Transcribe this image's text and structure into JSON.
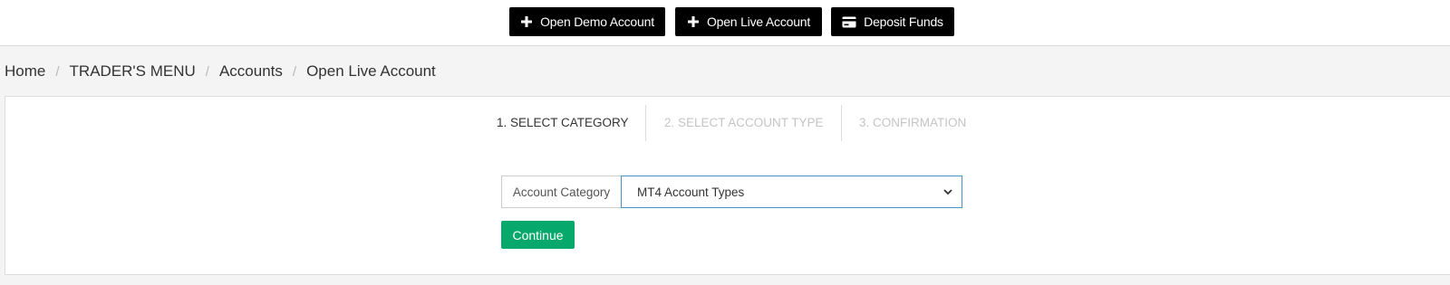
{
  "header": {
    "buttons": [
      {
        "label": "Open Demo Account",
        "icon": "plus-icon"
      },
      {
        "label": "Open Live Account",
        "icon": "plus-icon"
      },
      {
        "label": "Deposit Funds",
        "icon": "credit-card-icon"
      }
    ]
  },
  "breadcrumb": {
    "items": [
      "Home",
      "TRADER'S MENU",
      "Accounts",
      "Open Live Account"
    ],
    "separator": "/"
  },
  "wizard": {
    "steps": [
      {
        "label": "1. SELECT CATEGORY",
        "state": "active"
      },
      {
        "label": "2. SELECT ACCOUNT TYPE",
        "state": "inactive"
      },
      {
        "label": "3. CONFIRMATION",
        "state": "inactive"
      }
    ]
  },
  "form": {
    "category_label": "Account Category",
    "category_value": "MT4 Account Types",
    "continue_label": "Continue"
  },
  "colors": {
    "header_button_bg": "#000000",
    "continue_bg": "#07a86c",
    "select_border": "#4a90c8",
    "page_bg": "#f4f4f4"
  }
}
